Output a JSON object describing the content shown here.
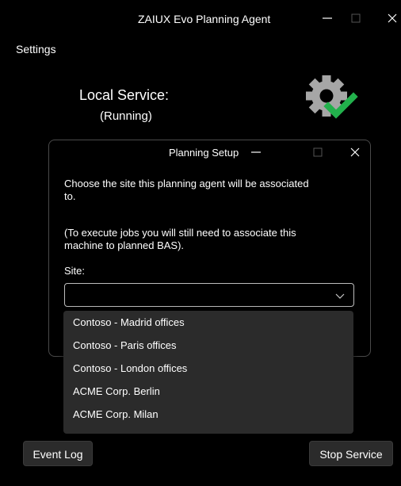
{
  "window": {
    "title": "ZAIUX Evo Planning Agent"
  },
  "menu": {
    "settings_label": "Settings"
  },
  "service": {
    "label": "Local Service:",
    "status": "(Running)",
    "icon": "gear-check-icon",
    "status_color": "#22b14c"
  },
  "dialog": {
    "title": "Planning Setup",
    "paragraph1": "Choose the site this planning agent will be associated to.",
    "paragraph2": "(To execute jobs you will still need to associate this machine to planned BAS).",
    "site_label": "Site:",
    "site_value": "",
    "site_options": [
      "Contoso - Madrid offices",
      "Contoso - Paris offices",
      "Contoso - London offices",
      "ACME Corp. Berlin",
      "ACME Corp. Milan"
    ]
  },
  "footer": {
    "event_log_label": "Event Log",
    "stop_service_label": "Stop Service"
  }
}
